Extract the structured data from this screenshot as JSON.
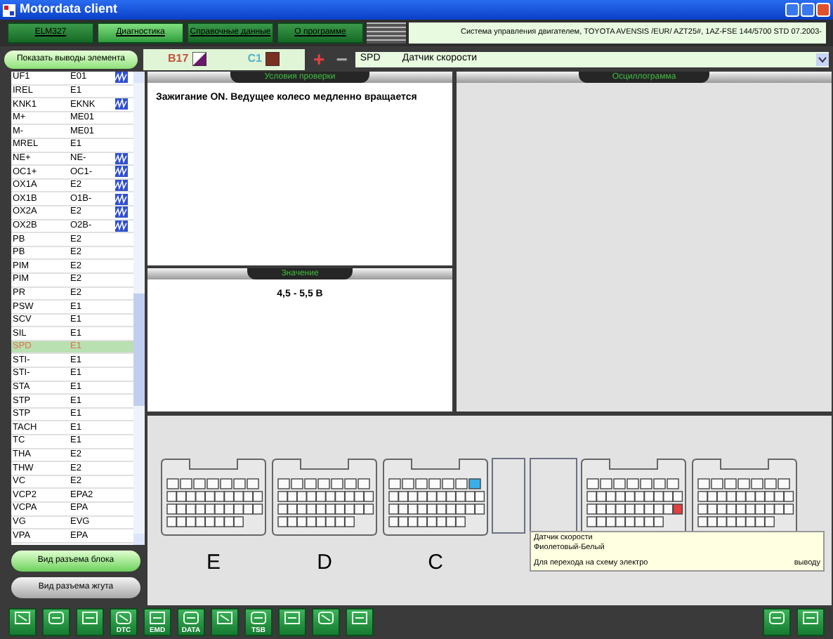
{
  "window": {
    "title": "Motordata client"
  },
  "tabs": [
    {
      "label": "ELM327",
      "selected": false
    },
    {
      "label": "Диагностика",
      "selected": true
    },
    {
      "label": "Справочные данные",
      "selected": false
    },
    {
      "label": "О программе",
      "selected": false
    }
  ],
  "vehicle_info": "Система управления двигателем, TOYOTA  AVENSIS /EUR/  AZT25#,   1AZ-FSE  144/5700  STD  07.2003-",
  "show_pins_button": "Показать выводы элемента",
  "wire_pins": [
    {
      "label": "B17",
      "color": "#c2553f"
    },
    {
      "label": "C1",
      "color": "#5bb3c9"
    }
  ],
  "zoom_buttons": [
    "+",
    "−"
  ],
  "signal_select": {
    "code": "SPD",
    "name": "Датчик скорости"
  },
  "pins": [
    {
      "name": "UF1",
      "ground": "E01",
      "wave": true,
      "selected": false
    },
    {
      "name": "IREL",
      "ground": "E1",
      "wave": false,
      "selected": false
    },
    {
      "name": "KNK1",
      "ground": "EKNK",
      "wave": true,
      "selected": false
    },
    {
      "name": "M+",
      "ground": "ME01",
      "wave": false,
      "selected": false
    },
    {
      "name": "M-",
      "ground": "ME01",
      "wave": false,
      "selected": false
    },
    {
      "name": "MREL",
      "ground": "E1",
      "wave": false,
      "selected": false
    },
    {
      "name": "NE+",
      "ground": "NE-",
      "wave": true,
      "selected": false
    },
    {
      "name": "OC1+",
      "ground": "OC1-",
      "wave": true,
      "selected": false
    },
    {
      "name": "OX1A",
      "ground": "E2",
      "wave": true,
      "selected": false
    },
    {
      "name": "OX1B",
      "ground": "O1B-",
      "wave": true,
      "selected": false
    },
    {
      "name": "OX2A",
      "ground": "E2",
      "wave": true,
      "selected": false
    },
    {
      "name": "OX2B",
      "ground": "O2B-",
      "wave": true,
      "selected": false
    },
    {
      "name": "PB",
      "ground": "E2",
      "wave": false,
      "selected": false
    },
    {
      "name": "PB",
      "ground": "E2",
      "wave": false,
      "selected": false
    },
    {
      "name": "PIM",
      "ground": "E2",
      "wave": false,
      "selected": false
    },
    {
      "name": "PIM",
      "ground": "E2",
      "wave": false,
      "selected": false
    },
    {
      "name": "PR",
      "ground": "E2",
      "wave": false,
      "selected": false
    },
    {
      "name": "PSW",
      "ground": "E1",
      "wave": false,
      "selected": false
    },
    {
      "name": "SCV",
      "ground": "E1",
      "wave": false,
      "selected": false
    },
    {
      "name": "SIL",
      "ground": "E1",
      "wave": false,
      "selected": false
    },
    {
      "name": "SPD",
      "ground": "E1",
      "wave": false,
      "selected": true
    },
    {
      "name": "STI-",
      "ground": "E1",
      "wave": false,
      "selected": false
    },
    {
      "name": "STI-",
      "ground": "E1",
      "wave": false,
      "selected": false
    },
    {
      "name": "STA",
      "ground": "E1",
      "wave": false,
      "selected": false
    },
    {
      "name": "STP",
      "ground": "E1",
      "wave": false,
      "selected": false
    },
    {
      "name": "STP",
      "ground": "E1",
      "wave": false,
      "selected": false
    },
    {
      "name": "TACH",
      "ground": "E1",
      "wave": false,
      "selected": false
    },
    {
      "name": "TC",
      "ground": "E1",
      "wave": false,
      "selected": false
    },
    {
      "name": "THA",
      "ground": "E2",
      "wave": false,
      "selected": false
    },
    {
      "name": "THW",
      "ground": "E2",
      "wave": false,
      "selected": false
    },
    {
      "name": "VC",
      "ground": "E2",
      "wave": false,
      "selected": false
    },
    {
      "name": "VCP2",
      "ground": "EPA2",
      "wave": false,
      "selected": false
    },
    {
      "name": "VCPA",
      "ground": "EPA",
      "wave": false,
      "selected": false
    },
    {
      "name": "VG",
      "ground": "EVG",
      "wave": false,
      "selected": false
    },
    {
      "name": "VPA",
      "ground": "EPA",
      "wave": false,
      "selected": false
    }
  ],
  "view_buttons": [
    {
      "label": "Вид разъема блока",
      "selected": true
    },
    {
      "label": "Вид разъема жгута",
      "selected": false
    }
  ],
  "conditions": {
    "header": "Условия проверки",
    "text": "Зажигание ON. Ведущее колесо медленно вращается"
  },
  "value": {
    "header": "Значение",
    "text": "4,5 - 5,5 В"
  },
  "oscillogram": {
    "header": "Осциллограмма"
  },
  "connectors": [
    {
      "label": "E",
      "kind": "plain"
    },
    {
      "label": "D",
      "kind": "plain"
    },
    {
      "label": "C",
      "kind": "selected"
    },
    {
      "kind": "blank"
    },
    {
      "kind": "error"
    },
    {
      "kind": "plain"
    }
  ],
  "tooltip": {
    "lines": [
      "Датчик скорости",
      "Фиолетовый-Белый"
    ],
    "hint_start": "Для перехода на схему электро",
    "hint_end": "выводу"
  },
  "toolbar": [
    {
      "kind": "icon"
    },
    {
      "kind": "icon"
    },
    {
      "kind": "icon"
    },
    {
      "kind": "icon",
      "label": "DTC"
    },
    {
      "kind": "icon",
      "label": "EMD"
    },
    {
      "kind": "icon",
      "label": "DATA"
    },
    {
      "kind": "icon"
    },
    {
      "kind": "icon",
      "label": "TSB"
    },
    {
      "kind": "icon"
    },
    {
      "kind": "icon"
    },
    {
      "kind": "icon"
    }
  ],
  "toolbar_right": [
    {
      "kind": "icon"
    },
    {
      "kind": "icon"
    }
  ]
}
